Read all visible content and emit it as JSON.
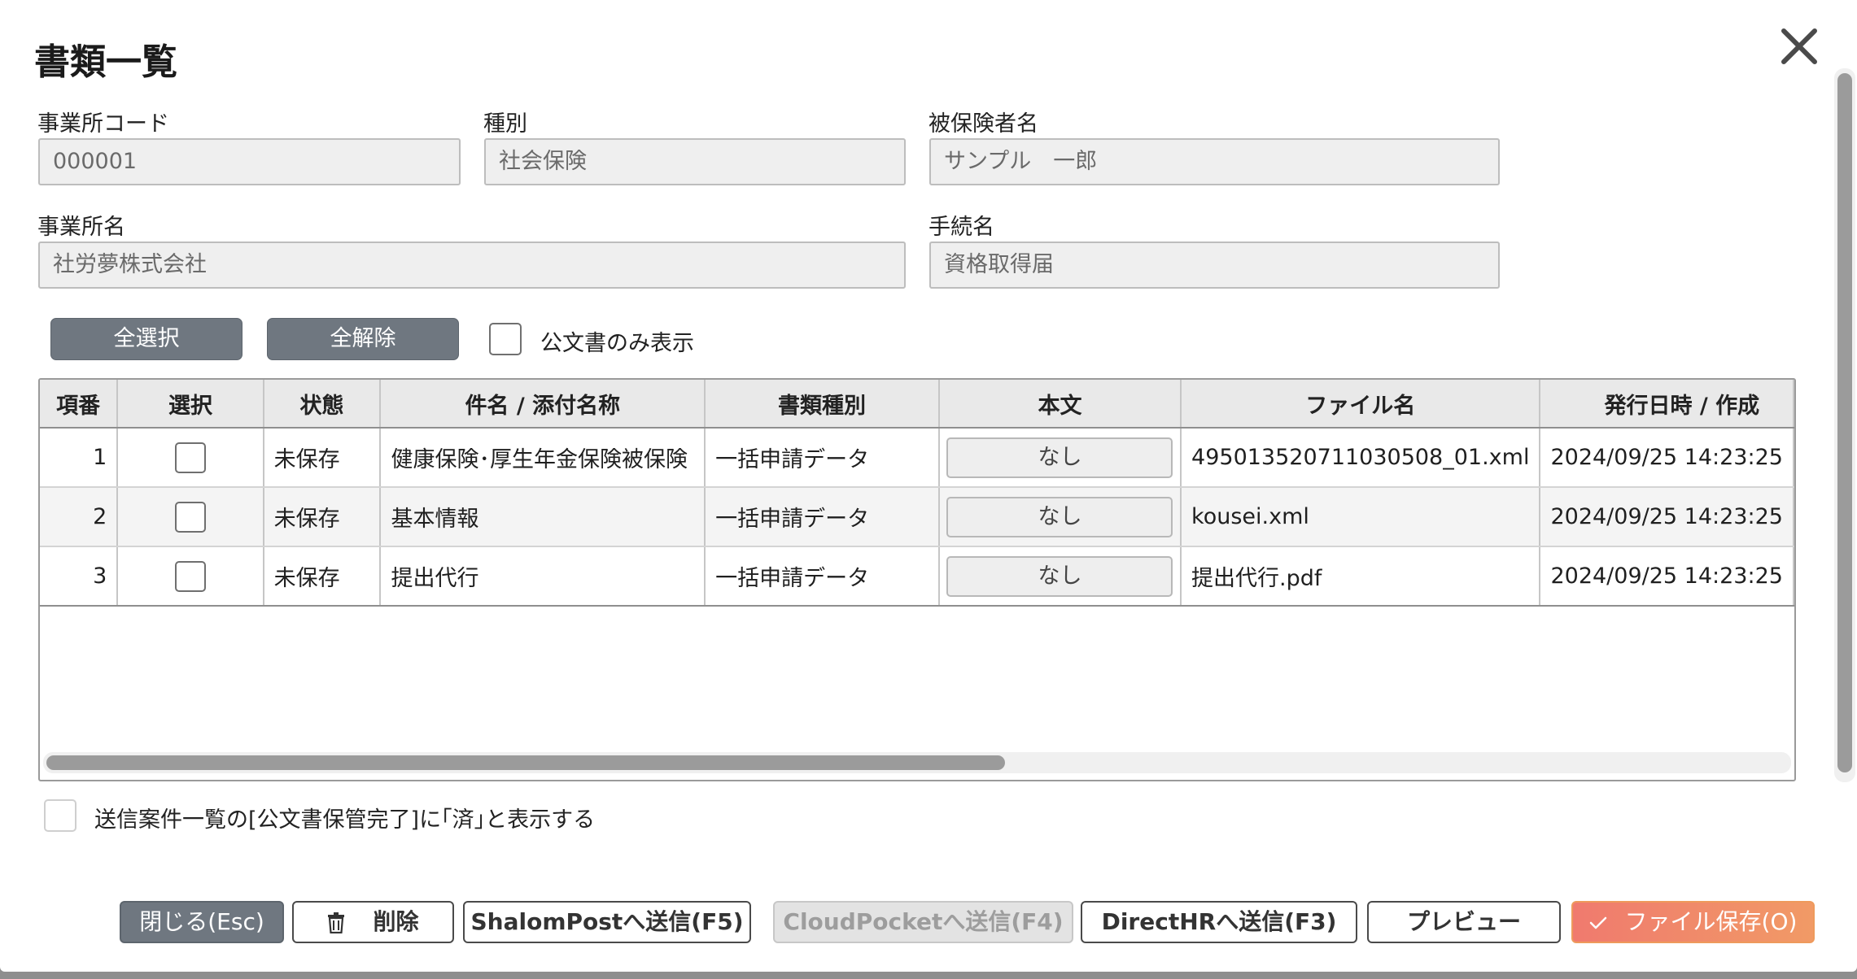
{
  "dialog": {
    "title": "書類一覧"
  },
  "fields": {
    "office_code": {
      "label": "事業所コード",
      "value": "000001"
    },
    "kind": {
      "label": "種別",
      "value": "社会保険"
    },
    "insured_name": {
      "label": "被保険者名",
      "value": "サンプル　一郎"
    },
    "office_name": {
      "label": "事業所名",
      "value": "社労夢株式会社"
    },
    "procedure_name": {
      "label": "手続名",
      "value": "資格取得届"
    }
  },
  "controls": {
    "select_all": "全選択",
    "deselect_all": "全解除",
    "official_only_label": "公文書のみ表示",
    "official_only_checked": false
  },
  "table": {
    "headers": [
      "項番",
      "選択",
      "状態",
      "件名 / 添付名称",
      "書類種別",
      "本文",
      "ファイル名",
      "発行日時 / 作成"
    ],
    "rows": [
      {
        "no": "1",
        "selected": false,
        "status": "未保存",
        "subject": "健康保険･厚生年金保険被保険",
        "doc_type": "一括申請データ",
        "body": "なし",
        "file": "495013520711030508_01.xml",
        "date": "2024/09/25 14:23:25"
      },
      {
        "no": "2",
        "selected": false,
        "status": "未保存",
        "subject": "基本情報",
        "doc_type": "一括申請データ",
        "body": "なし",
        "file": "kousei.xml",
        "date": "2024/09/25 14:23:25"
      },
      {
        "no": "3",
        "selected": false,
        "status": "未保存",
        "subject": "提出代行",
        "doc_type": "一括申請データ",
        "body": "なし",
        "file": "提出代行.pdf",
        "date": "2024/09/25 14:23:25"
      }
    ]
  },
  "footer": {
    "show_done_label": "送信案件一覧の[公文書保管完了]に｢済｣と表示する",
    "show_done_checked": false,
    "buttons": {
      "close": "閉じる(Esc)",
      "delete": "削除",
      "shalom": "ShalomPostへ送信(F5)",
      "cloud": "CloudPocketへ送信(F4)",
      "directhr": "DirectHRへ送信(F3)",
      "preview": "プレビュー",
      "save": "ファイル保存(O)"
    }
  },
  "colors": {
    "gray_button": "#6f7780",
    "save_button": "#f08a6a",
    "header_bg": "#e9e9e9"
  }
}
